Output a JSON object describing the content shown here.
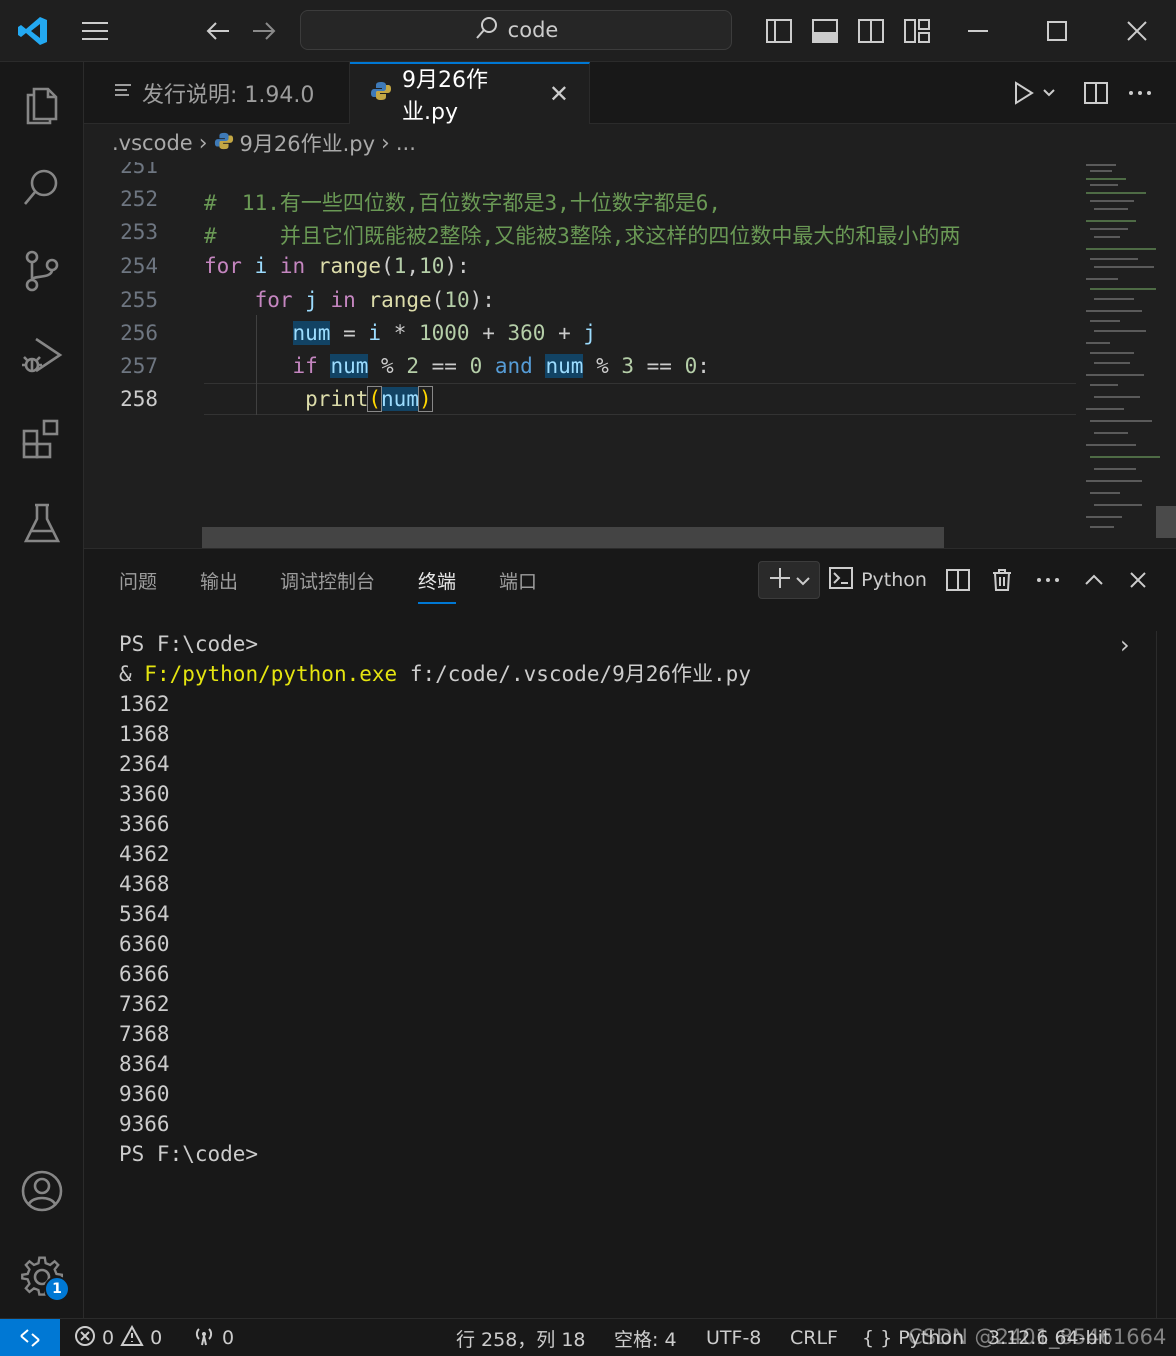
{
  "titlebar": {
    "search_text": "code"
  },
  "tabs": {
    "release_notes": "发行说明: 1.94.0",
    "active_file": "9月26作业.py",
    "close_glyph": "✕"
  },
  "breadcrumb": {
    "folder": ".vscode",
    "file": "9月26作业.py",
    "more": "..."
  },
  "editor": {
    "line_numbers": [
      "251",
      "252",
      "253",
      "254",
      "255",
      "256",
      "257",
      "258"
    ],
    "partial_line_251": "\"\"\"",
    "comment_252": "#  11.有一些四位数,百位数字都是3,十位数字都是6,",
    "comment_253": "#     并且它们既能被2整除,又能被3整除,求这样的四位数中最大的和最小的两",
    "current_line": "258"
  },
  "panel": {
    "tabs": [
      "问题",
      "输出",
      "调试控制台",
      "终端",
      "端口"
    ],
    "active_tab": "终端",
    "shell_label": "Python"
  },
  "terminal": {
    "prompt_1": "PS F:\\code>",
    "cmd_prefix": "& ",
    "cmd_exe": "F:/python/python.exe",
    "cmd_arg": " f:/code/.vscode/9月26作业.py",
    "outputs": [
      "1362",
      "1368",
      "2364",
      "3360",
      "3366",
      "4362",
      "4368",
      "5364",
      "6360",
      "6366",
      "7362",
      "7368",
      "8364",
      "9360",
      "9366"
    ],
    "prompt_2": "PS F:\\code>"
  },
  "activity": {
    "settings_badge": "1"
  },
  "statusbar": {
    "errors": "0",
    "warnings": "0",
    "ports": "0",
    "position": "行 258，列 18",
    "spaces": "空格: 4",
    "encoding": "UTF-8",
    "eol": "CRLF",
    "lang_braces": "{ }",
    "language": "Python",
    "interpreter": "3.12.6 64-bit"
  },
  "watermark": "CSDN @2401_85461664",
  "colors": {
    "accent": "#0078d4",
    "keyword": "#569cd6",
    "control_keyword": "#c586c0",
    "function": "#dcdcaa",
    "variable": "#9cdcfe",
    "number": "#b5cea8",
    "comment": "#6a9955",
    "terminal_yellow": "#e5e510"
  },
  "icons": [
    "vscode-logo-icon",
    "menu-icon",
    "arrow-left-icon",
    "arrow-right-icon",
    "search-icon",
    "layout-sidebar-left-icon",
    "layout-panel-icon",
    "layout-sidebar-right-icon",
    "layout-customize-icon",
    "minimize-icon",
    "maximize-icon",
    "close-icon",
    "files-icon",
    "search-icon",
    "source-control-icon",
    "run-debug-icon",
    "extensions-icon",
    "testing-icon",
    "account-icon",
    "gear-icon",
    "python-file-icon",
    "run-icon",
    "split-editor-icon",
    "more-icon",
    "terminal-icon",
    "trash-icon",
    "chevron-up-icon",
    "remote-icon"
  ]
}
